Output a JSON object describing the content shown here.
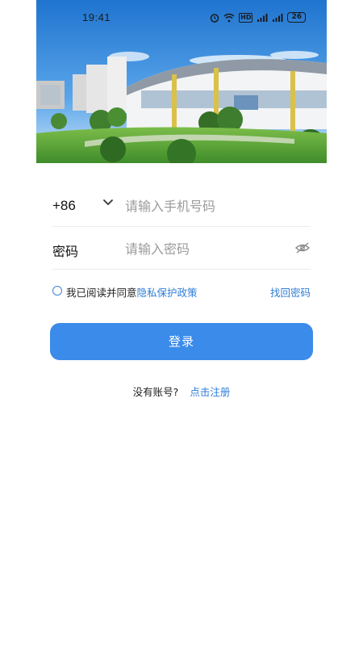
{
  "status_bar": {
    "time": "19:41",
    "hd_badge": "HD",
    "signal_label": "4G",
    "battery": "26"
  },
  "hero": {
    "image_icon": "campus-photo",
    "sky_color": "#2e86d8",
    "grass_color": "#5aa63a"
  },
  "login_form": {
    "country_code": "+86",
    "phone_placeholder": "请输入手机号码",
    "password_label": "密码",
    "password_placeholder": "请输入密码",
    "eye_icon": "eye-off-icon",
    "agree_text": "我已阅读并同意",
    "privacy_link": "隐私保护政策",
    "forgot_link": "找回密码",
    "login_button": "登录",
    "no_account_text": "没有账号?",
    "register_link": "点击注册"
  },
  "colors": {
    "accent": "#3b8bea",
    "link": "#2f7ed8"
  }
}
